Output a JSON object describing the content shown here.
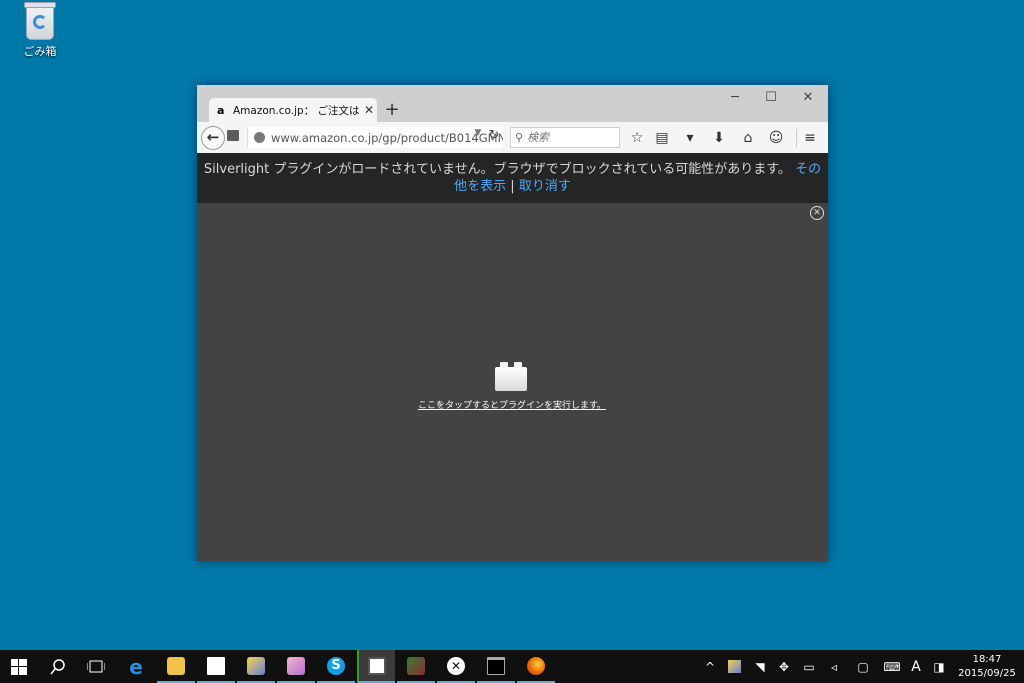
{
  "desktop": {
    "recycle_bin_label": "ごみ箱"
  },
  "browser": {
    "tab_title": "Amazon.co.jp： ご注文はう...",
    "tab_favicon": "a",
    "new_tab_icon": "plus-icon",
    "url": "www.amazon.co.jp/gp/product/B014GMN",
    "search_placeholder": "検索",
    "infobar": {
      "message": "Silverlight プラグインがロードされていません。ブラウザでブロックされている可能性があります。",
      "more_link": "その他を表示",
      "separator": "|",
      "cancel_link": "取り消す"
    },
    "plugin_prompt": "ここをタップするとプラグインを実行します。"
  },
  "taskbar": {
    "apps": [
      "start-icon",
      "search-icon",
      "task-view-icon",
      "edge-icon",
      "file-explorer-icon",
      "store-icon",
      "app-icon",
      "app-icon",
      "skype-icon",
      "active-app-icon",
      "app-icon",
      "xbox-icon",
      "terminal-icon",
      "firefox-icon"
    ],
    "ime_label": "A",
    "clock": {
      "time": "18:47",
      "date": "2015/09/25"
    }
  },
  "colors": {
    "desktop": "#0078a8",
    "link": "#4aa9ff",
    "infobar": "#252525",
    "content": "#434343"
  }
}
